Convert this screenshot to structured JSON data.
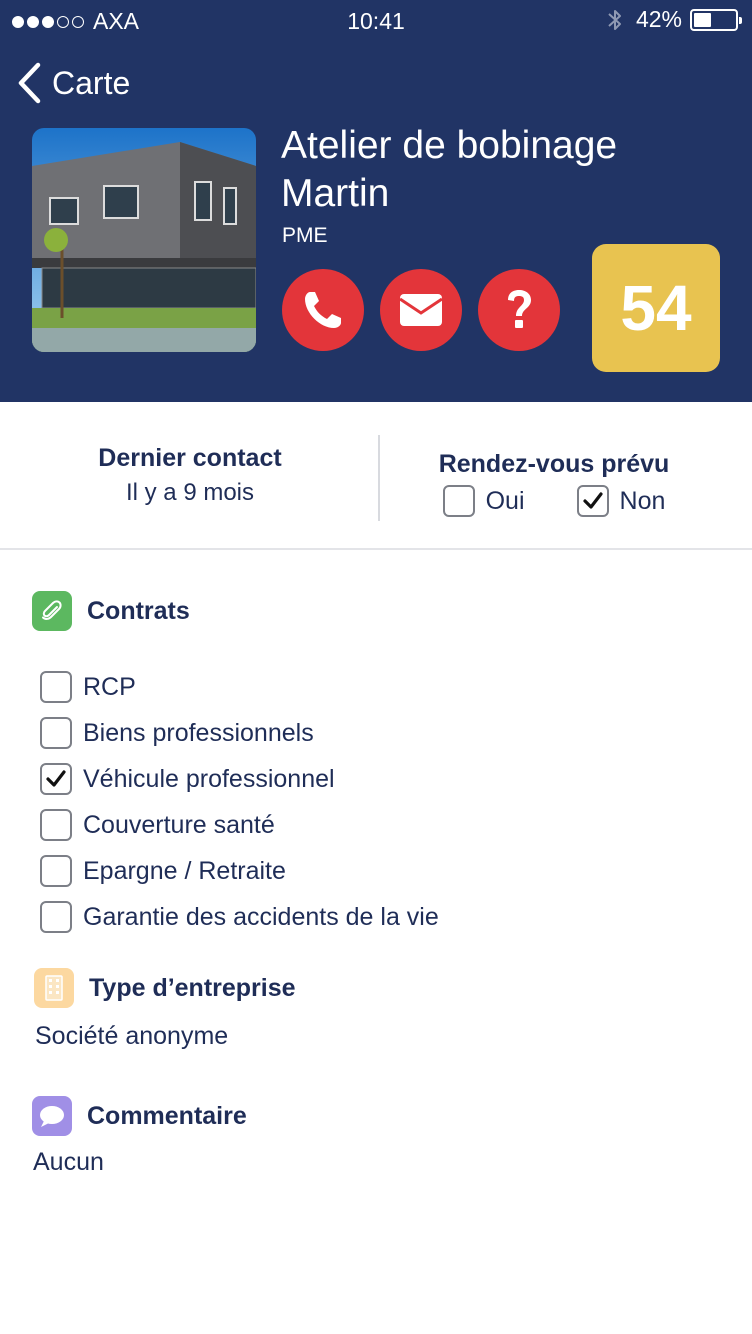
{
  "status_bar": {
    "carrier": "AXA",
    "time": "10:41",
    "battery_percent": "42%",
    "battery_level": 0.42,
    "signal_bars": 3
  },
  "nav": {
    "back_label": "Carte"
  },
  "company": {
    "name": "Atelier de bobinage Martin",
    "category": "PME",
    "score": "54"
  },
  "actions": {
    "call_icon": "phone-icon",
    "mail_icon": "envelope-icon",
    "help_icon": "question-icon"
  },
  "contact": {
    "last_contact_title": "Dernier contact",
    "last_contact_value": "Il y a 9 mois",
    "appointment_title": "Rendez-vous prévu",
    "options": [
      {
        "label": "Oui",
        "checked": false
      },
      {
        "label": "Non",
        "checked": true
      }
    ]
  },
  "contracts": {
    "title": "Contrats",
    "items": [
      {
        "label": "RCP",
        "checked": false
      },
      {
        "label": "Biens professionnels",
        "checked": false
      },
      {
        "label": "Véhicule professionnel",
        "checked": true
      },
      {
        "label": "Couverture santé",
        "checked": false
      },
      {
        "label": "Epargne / Retraite",
        "checked": false
      },
      {
        "label": "Garantie des accidents de la vie",
        "checked": false
      }
    ]
  },
  "company_type": {
    "title": "Type d’entreprise",
    "value": "Société anonyme"
  },
  "comment": {
    "title": "Commentaire",
    "value": "Aucun"
  },
  "colors": {
    "header_bg": "#213465",
    "action_red": "#e3353a",
    "score_yellow": "#e8c350",
    "contracts_green": "#5cb860",
    "type_orange": "#fcd8a0",
    "comment_purple": "#a08fe6",
    "text_navy": "#1f2d57"
  }
}
